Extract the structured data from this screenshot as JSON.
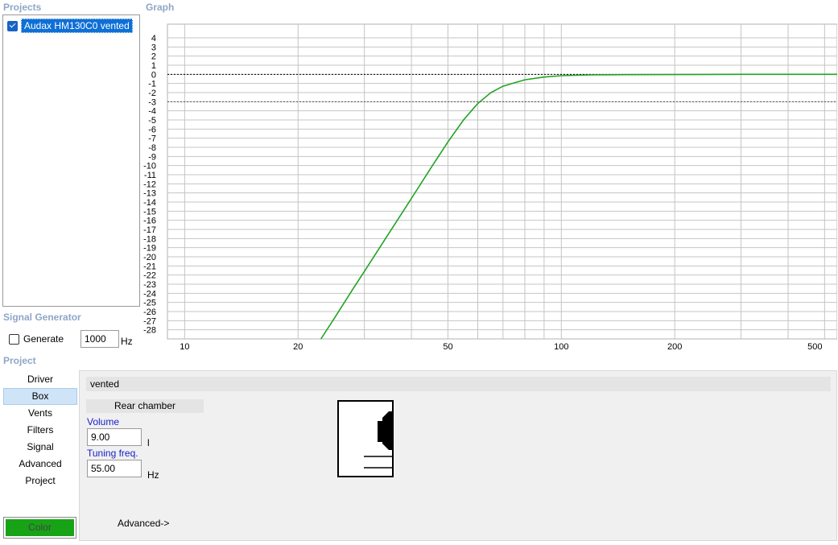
{
  "projects": {
    "title": "Projects",
    "items": [
      {
        "label": "Audax HM130C0 vented",
        "checked": true
      }
    ]
  },
  "signal_generator": {
    "title": "Signal Generator",
    "generate_label": "Generate",
    "generate_checked": false,
    "frequency_value": "1000",
    "frequency_unit": "Hz"
  },
  "graph": {
    "title": "Graph"
  },
  "chart_data": {
    "type": "line",
    "x_scale": "log",
    "xlim": [
      9,
      540
    ],
    "ylim": [
      -29,
      5.5
    ],
    "x_ticks": [
      10,
      20,
      50,
      100,
      200,
      500
    ],
    "y_ticks": [
      4,
      3,
      2,
      1,
      0,
      -1,
      -2,
      -3,
      -4,
      -5,
      -6,
      -7,
      -8,
      -9,
      -10,
      -11,
      -12,
      -13,
      -14,
      -15,
      -16,
      -17,
      -18,
      -19,
      -20,
      -21,
      -22,
      -23,
      -24,
      -25,
      -26,
      -27,
      -28
    ],
    "reference_lines": [
      {
        "y": 0,
        "style": "dotted",
        "color": "#000000"
      },
      {
        "y": -3,
        "style": "dotted",
        "color": "#555555"
      }
    ],
    "grid": true,
    "series": [
      {
        "color": "#21a321",
        "x": [
          23,
          25,
          28,
          30,
          35,
          40,
          45,
          50,
          55,
          60,
          65,
          70,
          80,
          90,
          100,
          120,
          150,
          200,
          300,
          500,
          540
        ],
        "y": [
          -29,
          -26.7,
          -23.5,
          -21.6,
          -17.3,
          -13.6,
          -10.3,
          -7.4,
          -5.0,
          -3.2,
          -2.0,
          -1.3,
          -0.6,
          -0.3,
          -0.15,
          -0.06,
          -0.03,
          -0.02,
          0,
          0,
          0
        ]
      }
    ]
  },
  "project_section": {
    "title": "Project",
    "nav": [
      {
        "label": "Driver",
        "selected": false
      },
      {
        "label": "Box",
        "selected": true
      },
      {
        "label": "Vents",
        "selected": false
      },
      {
        "label": "Filters",
        "selected": false
      },
      {
        "label": "Signal",
        "selected": false
      },
      {
        "label": "Advanced",
        "selected": false
      },
      {
        "label": "Project",
        "selected": false
      }
    ],
    "color_button_label": "Color",
    "color_value": "#18a316"
  },
  "box_panel": {
    "box_type": "vented",
    "rear_chamber_label": "Rear chamber",
    "volume_label": "Volume",
    "volume_value": "9.00",
    "volume_unit": "l",
    "tuning_label": "Tuning freq.",
    "tuning_value": "55.00",
    "tuning_unit": "Hz",
    "advanced_link": "Advanced->"
  }
}
